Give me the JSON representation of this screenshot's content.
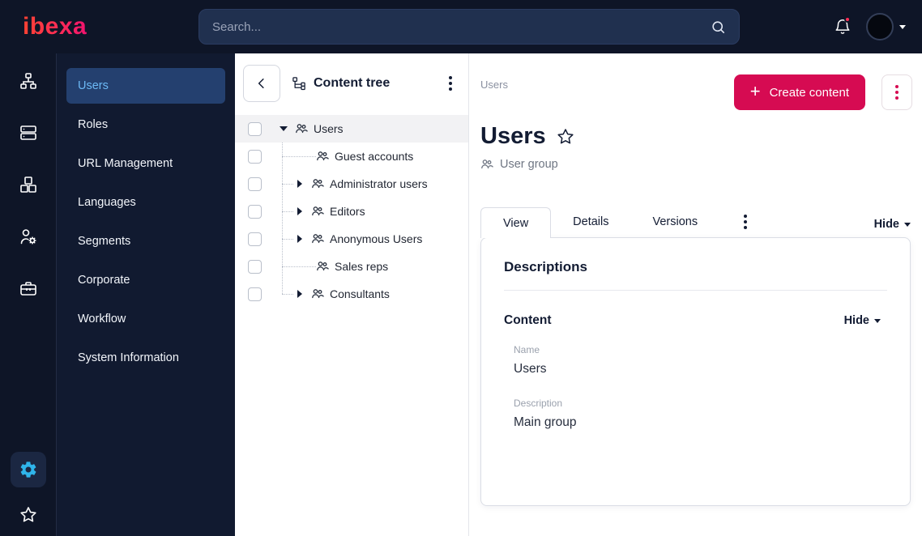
{
  "topbar": {
    "logo": "ibexa",
    "search_placeholder": "Search..."
  },
  "sidebar": {
    "items": [
      {
        "label": "Users",
        "active": true
      },
      {
        "label": "Roles"
      },
      {
        "label": "URL Management"
      },
      {
        "label": "Languages"
      },
      {
        "label": "Segments"
      },
      {
        "label": "Corporate"
      },
      {
        "label": "Workflow"
      },
      {
        "label": "System Information"
      }
    ]
  },
  "content_tree": {
    "title": "Content tree",
    "items": [
      {
        "label": "Users",
        "state": "expanded",
        "selected": true
      },
      {
        "label": "Guest accounts",
        "state": "leaf"
      },
      {
        "label": "Administrator users",
        "state": "collapsed"
      },
      {
        "label": "Editors",
        "state": "collapsed"
      },
      {
        "label": "Anonymous Users",
        "state": "collapsed"
      },
      {
        "label": "Sales reps",
        "state": "leaf"
      },
      {
        "label": "Consultants",
        "state": "collapsed"
      }
    ]
  },
  "main": {
    "breadcrumb": "Users",
    "create_button": "Create content",
    "title": "Users",
    "content_type": "User group",
    "tabs": [
      {
        "label": "View",
        "active": true
      },
      {
        "label": "Details"
      },
      {
        "label": "Versions"
      }
    ],
    "hide_label": "Hide",
    "card": {
      "heading": "Descriptions",
      "section_title": "Content",
      "section_toggle": "Hide",
      "fields": [
        {
          "label": "Name",
          "value": "Users"
        },
        {
          "label": "Description",
          "value": "Main group"
        }
      ]
    }
  },
  "colors": {
    "topbar_bg": "#0e1527",
    "sidebar_bg": "#111a30",
    "active_item_bg": "#24406f",
    "accent_blue": "#6cb9f5",
    "gear_teal": "#2fb4ea",
    "primary_magenta": "#d60b52",
    "logo_gradient": [
      "#ff4233",
      "#ff2d55",
      "#f0136e"
    ],
    "notification_red": "#ff2d55"
  },
  "icons": {
    "topbar": [
      "search-icon",
      "bell-icon",
      "caret-down-icon"
    ],
    "rail": [
      "sitemap-icon",
      "content-list-icon",
      "blocks-icon",
      "user-settings-icon",
      "toolbox-icon",
      "gear-icon",
      "star-icon"
    ],
    "tree": [
      "back-icon",
      "content-tree-icon",
      "kebab-icon",
      "user-group-icon",
      "caret-down-icon",
      "caret-right-icon"
    ],
    "main": [
      "plus-icon",
      "kebab-icon",
      "favorite-star-icon",
      "user-group-icon",
      "caret-down-icon"
    ]
  }
}
